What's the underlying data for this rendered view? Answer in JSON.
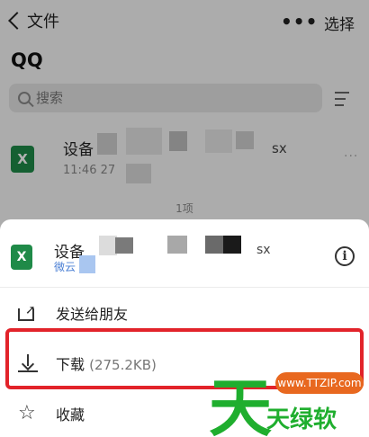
{
  "nav": {
    "back_label": "文件",
    "more": "•••",
    "select_label": "选择"
  },
  "page": {
    "title": "QQ"
  },
  "search": {
    "placeholder": "搜索"
  },
  "file_row": {
    "name": "设备",
    "ext": "sx",
    "meta": "11:46 27",
    "icon_letter": "X",
    "more": "···"
  },
  "file_count": "1项",
  "sheet": {
    "file_name": "设备",
    "file_ext": "sx",
    "file_source": "微云",
    "icon_letter": "X",
    "info": "i",
    "actions": [
      {
        "icon": "share-icon",
        "label": "发送给朋友",
        "size": ""
      },
      {
        "icon": "download-icon",
        "label": "下载",
        "size": "(275.2KB)"
      },
      {
        "icon": "star-icon",
        "label": "收藏",
        "size": ""
      }
    ]
  },
  "watermark": {
    "big_char": "天",
    "url": "www.TTZIP.com",
    "name": "天绿软"
  },
  "colors": {
    "excel_green": "#1f8a48",
    "highlight_red": "#e2232a",
    "watermark_green": "#1fae2e",
    "watermark_orange": "#e8681f",
    "link_blue": "#4a7fd4"
  }
}
